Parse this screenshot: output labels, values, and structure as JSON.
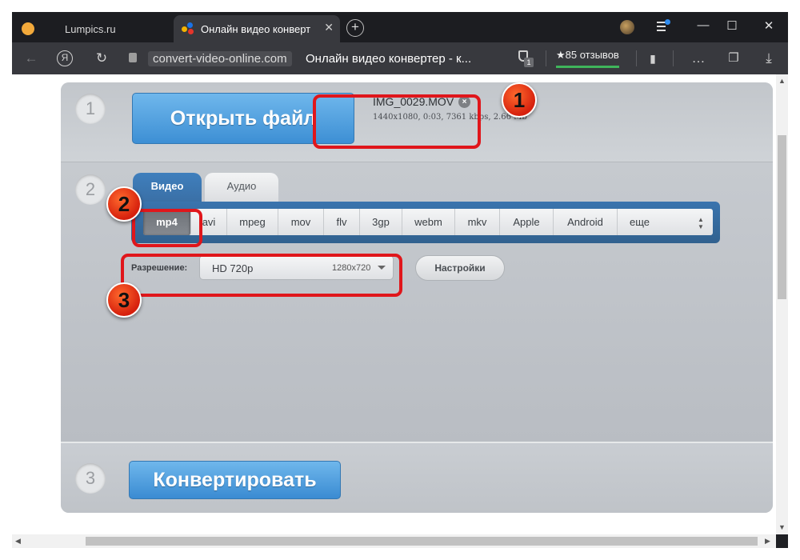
{
  "browser": {
    "tabs": [
      {
        "title": "Lumpics.ru",
        "active": false
      },
      {
        "title": "Онлайн видео конверт",
        "active": true
      }
    ],
    "tab_close": "✕",
    "new_tab": "+",
    "url_domain": "convert-video-online.com",
    "page_title": "Онлайн видео конвертер - к...",
    "reviews": "★85 отзывов",
    "ext_badge_count": "1",
    "window_controls": {
      "minimize": "—",
      "maximize": "☐",
      "close": "✕"
    },
    "accent_green": "#3fb55b"
  },
  "steps": {
    "step1": {
      "number": "1",
      "open_button": "Открыть файл",
      "file_name": "IMG_0029.MOV",
      "file_meta": "1440x1080, 0:03, 7361 kbps, 2.66 Mb"
    },
    "step2": {
      "number": "2",
      "tabs": {
        "video": "Видео",
        "audio": "Аудио"
      },
      "formats": [
        "mp4",
        "avi",
        "mpeg",
        "mov",
        "flv",
        "3gp",
        "webm",
        "mkv",
        "Apple",
        "Android",
        "еще"
      ],
      "selected_format": "mp4",
      "resolution_label": "Разрешение:",
      "resolution_value": "HD 720p",
      "resolution_dims": "1280x720",
      "settings_button": "Настройки"
    },
    "step3": {
      "number": "3",
      "convert_button": "Конвертировать"
    }
  },
  "annotations": {
    "badge1": "1",
    "badge2": "2",
    "badge3": "3",
    "color": "#e0161b"
  }
}
